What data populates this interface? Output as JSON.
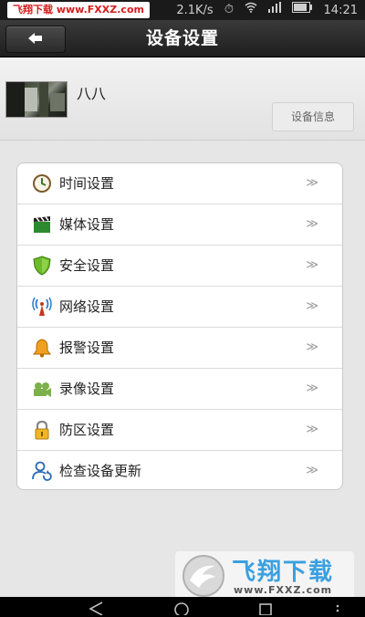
{
  "status_bar": {
    "watermark_text": "飞翔下载 www.FXXZ.com",
    "speed": "2.1K/s",
    "time": "14:21"
  },
  "header": {
    "title": "设备设置",
    "back_icon": "back-arrow-icon"
  },
  "device": {
    "name": "八八",
    "info_button": "设备信息"
  },
  "menu": {
    "arrow": "≫",
    "items": [
      {
        "label": "时间设置",
        "icon": "clock-icon"
      },
      {
        "label": "媒体设置",
        "icon": "clapperboard-icon"
      },
      {
        "label": "安全设置",
        "icon": "shield-icon"
      },
      {
        "label": "网络设置",
        "icon": "antenna-icon"
      },
      {
        "label": "报警设置",
        "icon": "bell-icon"
      },
      {
        "label": "录像设置",
        "icon": "video-camera-icon"
      },
      {
        "label": "防区设置",
        "icon": "lock-icon"
      },
      {
        "label": "检查设备更新",
        "icon": "user-refresh-icon"
      }
    ]
  },
  "watermark": {
    "brand": "飞翔下载",
    "url": "www.FXXZ.com"
  }
}
